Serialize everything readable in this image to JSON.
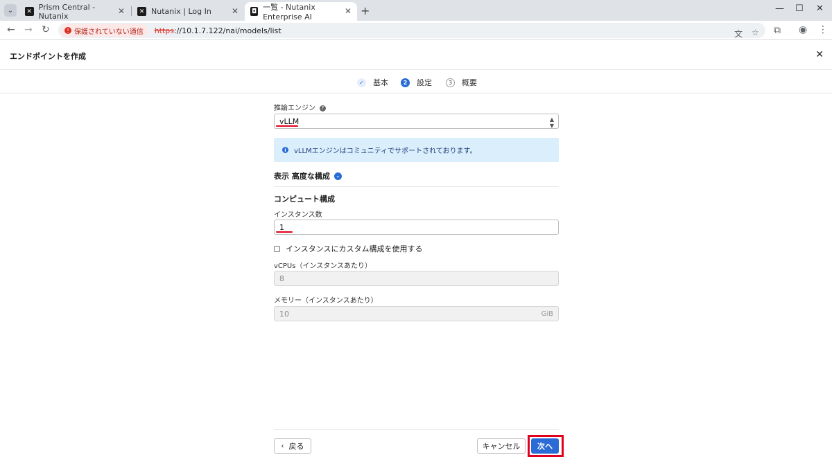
{
  "browser": {
    "tabs": [
      {
        "title": "Prism Central - Nutanix",
        "favicon": "nutanix-x-icon"
      },
      {
        "title": "Nutanix | Log In",
        "favicon": "nutanix-x-icon"
      },
      {
        "title": "一覧 - Nutanix Enterprise AI",
        "favicon": "nai-icon"
      }
    ],
    "security_chip": "保護されていない通信",
    "url_scheme": "https",
    "url_rest": "://10.1.7.122/nai/models/list"
  },
  "modal": {
    "title": "エンドポイントを作成"
  },
  "stepper": {
    "steps": [
      {
        "num": "✓",
        "label": "基本",
        "state": "done"
      },
      {
        "num": "2",
        "label": "設定",
        "state": "current"
      },
      {
        "num": "3",
        "label": "概要",
        "state": "pending"
      }
    ]
  },
  "form": {
    "engine_label": "推論エンジン",
    "engine_value": "vLLM",
    "info_text": "vLLMエンジンはコミュニティでサポートされております。",
    "advanced_toggle": "表示 高度な構成",
    "compute_title": "コンピュート構成",
    "instances_label": "インスタンス数",
    "instances_value": "1",
    "custom_checkbox_label": "インスタンスにカスタム構成を使用する",
    "vcpus_label": "vCPUs（インスタンスあたり）",
    "vcpus_value": "8",
    "memory_label": "メモリー（インスタンスあたり）",
    "memory_value": "10",
    "memory_unit": "GiB"
  },
  "footer": {
    "back_label": "戻る",
    "cancel_label": "キャンセル",
    "next_label": "次へ"
  },
  "colors": {
    "accent": "#2a6bd6",
    "highlight": "#e0001b",
    "info_bg": "#dbeefc"
  }
}
